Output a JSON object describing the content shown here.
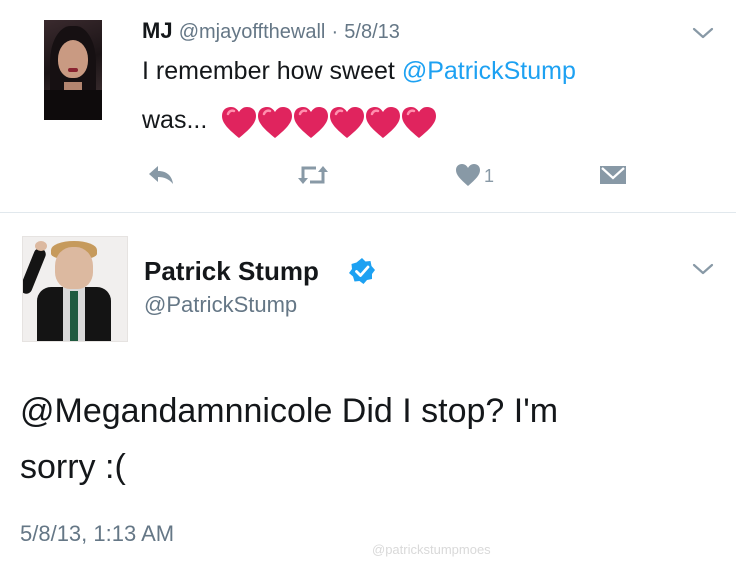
{
  "tweet_reply": {
    "name": "MJ",
    "handle": "@mjayoffthewall",
    "separator": "·",
    "date": "5/8/13",
    "text_before": "I remember how sweet ",
    "mention": "@PatrickStump",
    "text_after": "was...",
    "emoji": [
      "heart",
      "heart",
      "heart",
      "heart",
      "heart",
      "heart"
    ],
    "like_count": "1",
    "icons": [
      "reply-icon",
      "retweet-icon",
      "like-icon",
      "message-icon",
      "caret-down-icon"
    ]
  },
  "tweet_main": {
    "name": "Patrick Stump",
    "handle": "@PatrickStump",
    "verified": true,
    "text_line1": "@Megandamnnicole Did I stop? I'm",
    "text_line2": "sorry :(",
    "timestamp": "5/8/13, 1:13 AM"
  },
  "watermark": "@patrickstumpmoes",
  "colors": {
    "accent": "#1da1f2",
    "secondary_text": "#657786",
    "icon_gray": "#8899a6",
    "heart_red": "#e0245e"
  }
}
